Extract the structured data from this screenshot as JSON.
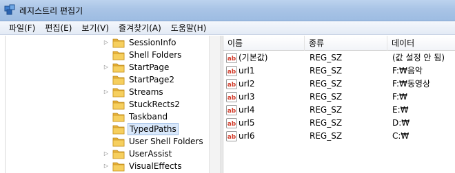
{
  "window": {
    "title": "레지스트리 편집기"
  },
  "menu": [
    "파일(F)",
    "편집(E)",
    "보기(V)",
    "즐겨찾기(A)",
    "도움말(H)"
  ],
  "tree": {
    "items": [
      {
        "label": "SessionInfo",
        "expandable": true
      },
      {
        "label": "Shell Folders",
        "expandable": false
      },
      {
        "label": "StartPage",
        "expandable": true
      },
      {
        "label": "StartPage2",
        "expandable": false
      },
      {
        "label": "Streams",
        "expandable": true
      },
      {
        "label": "StuckRects2",
        "expandable": false
      },
      {
        "label": "Taskband",
        "expandable": false
      },
      {
        "label": "TypedPaths",
        "expandable": false,
        "selected": true
      },
      {
        "label": "User Shell Folders",
        "expandable": false
      },
      {
        "label": "UserAssist",
        "expandable": true
      },
      {
        "label": "VisualEffects",
        "expandable": true
      }
    ]
  },
  "list": {
    "columns": [
      "이름",
      "종류",
      "데이터"
    ],
    "rows": [
      {
        "name": "(기본값)",
        "type": "REG_SZ",
        "data": "(값 설정 안 됨)"
      },
      {
        "name": "url1",
        "type": "REG_SZ",
        "data": "F:₩음악"
      },
      {
        "name": "url2",
        "type": "REG_SZ",
        "data": "F:₩동영상"
      },
      {
        "name": "url3",
        "type": "REG_SZ",
        "data": "F:₩"
      },
      {
        "name": "url4",
        "type": "REG_SZ",
        "data": "E:₩"
      },
      {
        "name": "url5",
        "type": "REG_SZ",
        "data": "D:₩"
      },
      {
        "name": "url6",
        "type": "REG_SZ",
        "data": "C:₩"
      }
    ]
  },
  "icons": {
    "app": "registry-editor-icon",
    "folder": "folder-icon",
    "value": "string-value-ab-icon",
    "expander": "expand-arrow-icon"
  },
  "colors": {
    "titlebar": "#a9c4e6",
    "selection": "#d9e8fb",
    "folder": "#f2c34e",
    "ab_icon": "#d23c2a"
  }
}
